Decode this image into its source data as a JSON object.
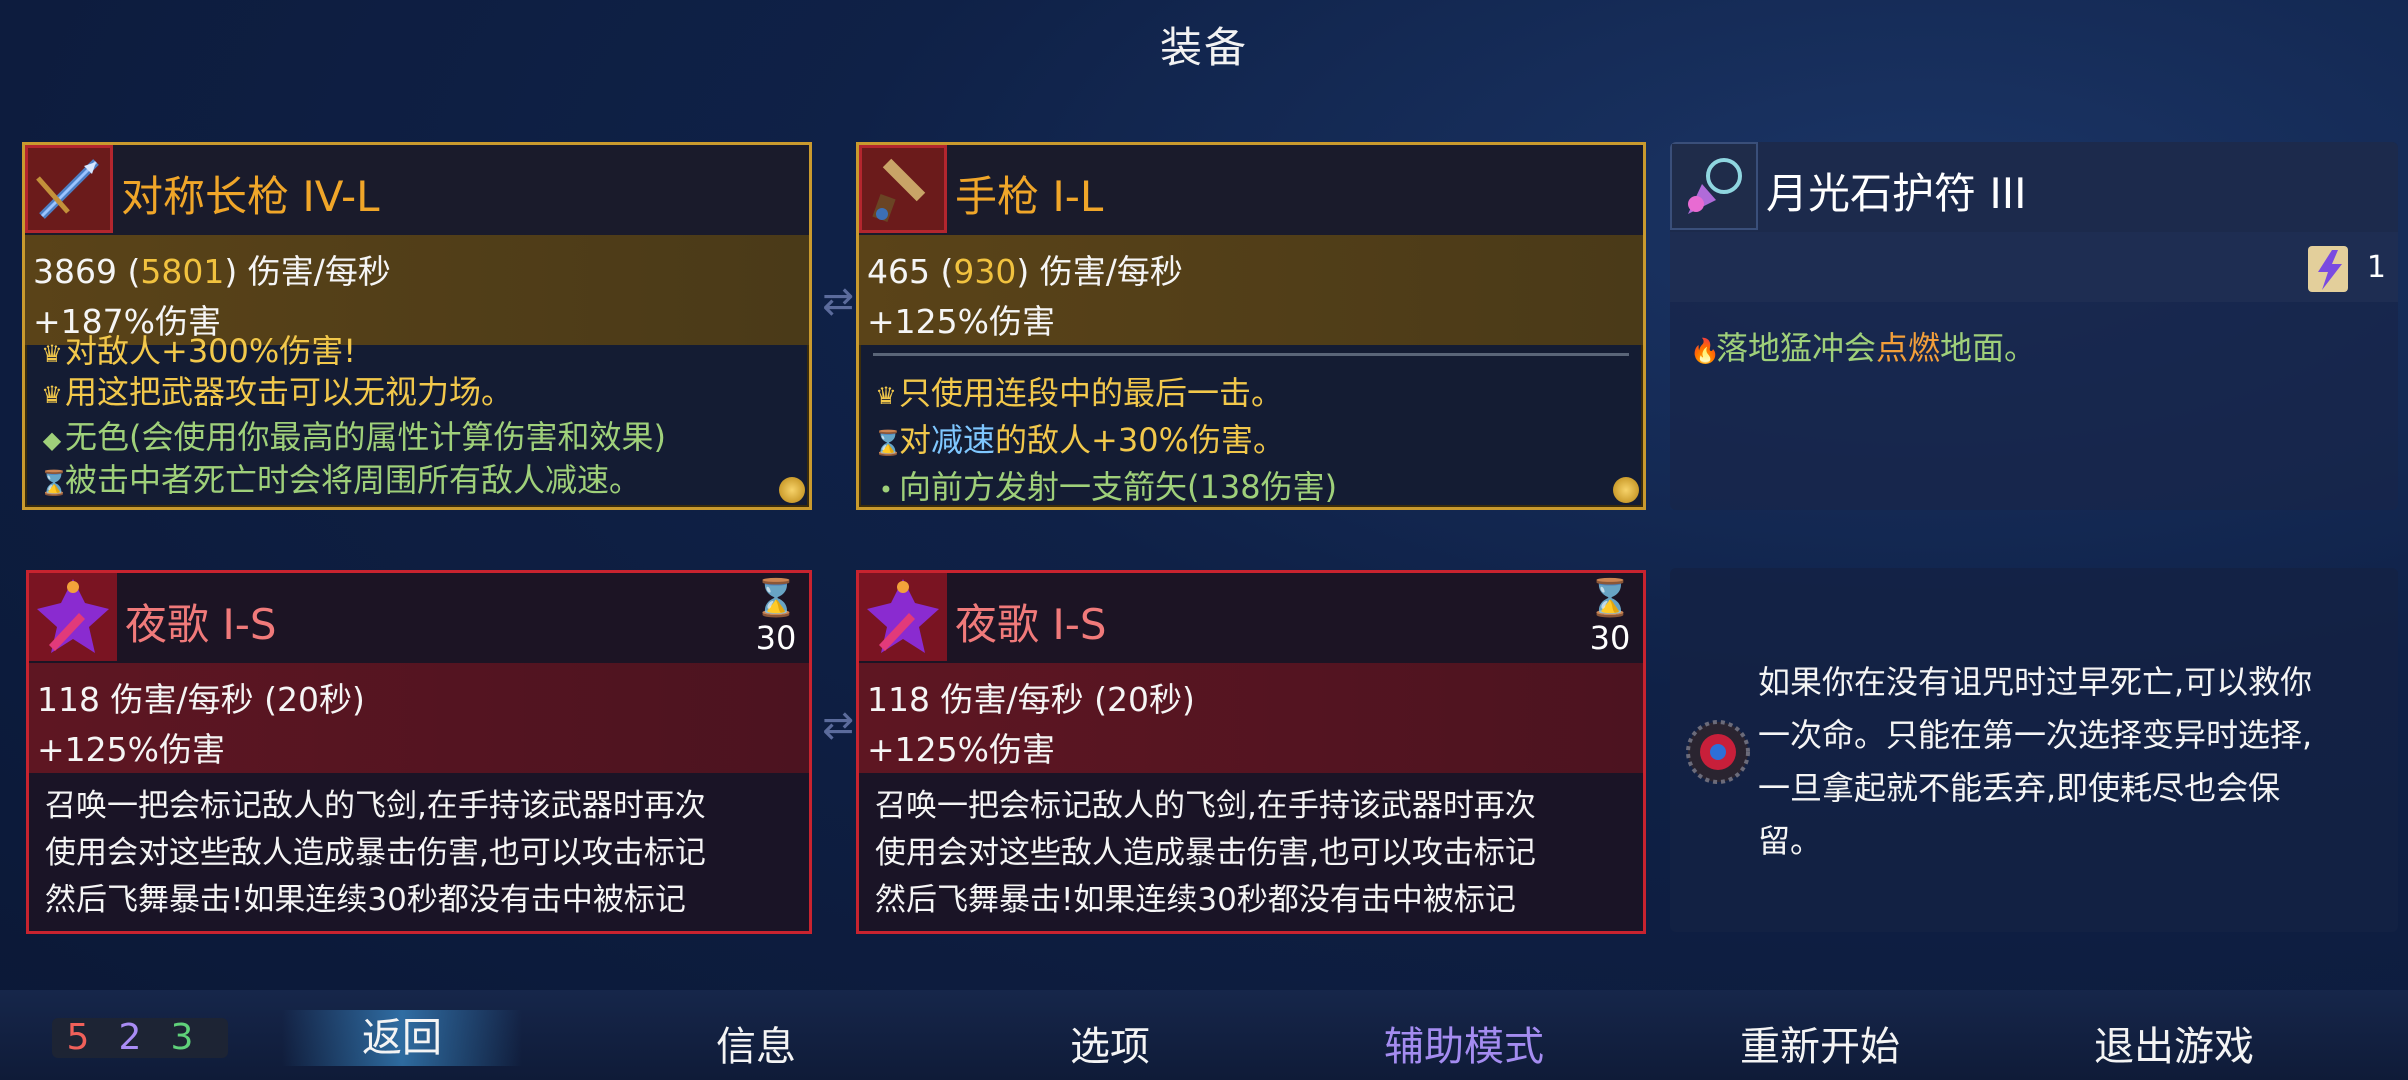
{
  "header": {
    "title": "装备"
  },
  "weapon1": {
    "name": "对称长枪 IV-L",
    "dps_base": "3869 (",
    "dps_high": "5801",
    "dps_tail": ") 伤害/每秒",
    "bonus": "+187%伤害",
    "lines": [
      "对敌人+300%伤害!",
      "用这把武器攻击可以无视力场。",
      "无色(会使用你最高的属性计算伤害和效果)",
      "被击中者死亡时会将周围所有敌人减速。"
    ]
  },
  "weapon2": {
    "name": "手枪 I-L",
    "dps_base": "465 (",
    "dps_high": "930",
    "dps_tail": ") 伤害/每秒",
    "bonus": "+125%伤害",
    "line1": "只使用连段中的最后一击。",
    "line2_pre": "对",
    "line2_hl": "减速",
    "line2_post": "的敌人+30%伤害。",
    "line3": "向前方发射一支箭矢(138伤害)"
  },
  "amulet": {
    "name": "月光石护符 III",
    "scroll_count": "1",
    "effect_pre": "落地猛冲会",
    "effect_hl": "点燃",
    "effect_post": "地面。"
  },
  "skill1": {
    "name": "夜歌 I-S",
    "cooldown": "30",
    "dps": "118 伤害/每秒 (20秒)",
    "bonus": "+125%伤害",
    "desc": [
      "召唤一把会标记敌人的飞剑,在手持该武器时再次",
      "使用会对这些敌人造成暴击伤害,也可以攻击标记",
      "然后飞舞暴击!如果连续30秒都没有击中被标记"
    ]
  },
  "skill2": {
    "name": "夜歌 I-S",
    "cooldown": "30",
    "dps": "118 伤害/每秒 (20秒)",
    "bonus": "+125%伤害",
    "desc": [
      "召唤一把会标记敌人的飞剑,在手持该武器时再次",
      "使用会对这些敌人造成暴击伤害,也可以攻击标记",
      "然后飞舞暴击!如果连续30秒都没有击中被标记"
    ]
  },
  "mutation": {
    "desc": [
      "如果你在没有诅咒时过早死亡,可以救你",
      "一次命。只能在第一次选择变异时选择,",
      "一旦拿起就不能丢弃,即使耗尽也会保",
      "留。"
    ]
  },
  "stats": {
    "brutality": "5",
    "tactics": "2",
    "survival": "3"
  },
  "menu": {
    "back": "返回",
    "info": "信息",
    "options": "选项",
    "assist": "辅助模式",
    "restart": "重新开始",
    "quit": "退出游戏"
  },
  "colors": {
    "gold_frame": "#c99a2e",
    "red_frame": "#c8232f",
    "brutality": "#f0605a",
    "tactics": "#a98cf5",
    "survival": "#5fd17a",
    "assist_text": "#a48cf0"
  },
  "icons": {
    "weapon1": "spear-icon",
    "weapon2": "pistol-icon",
    "amulet": "amulet-icon",
    "skill": "nightsong-icon",
    "mutation": "mutation-icon",
    "cooldown": "hourglass-icon",
    "scroll": "scroll-icon"
  }
}
